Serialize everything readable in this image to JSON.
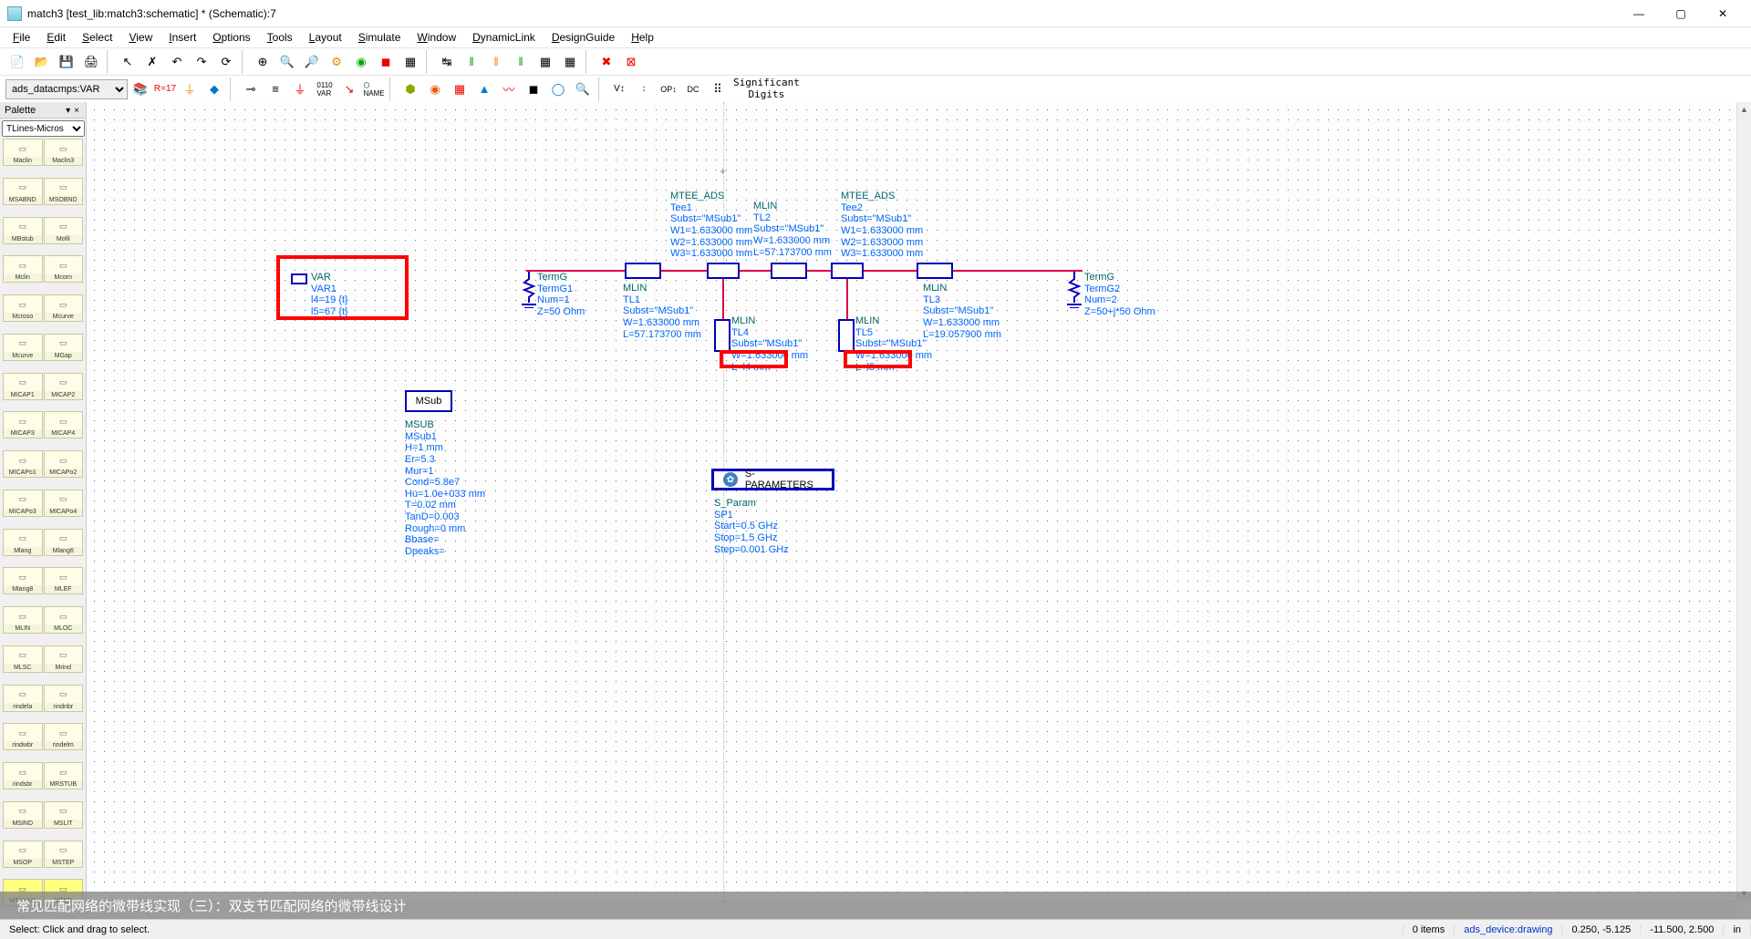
{
  "titlebar": {
    "title": "match3 [test_lib:match3:schematic] * (Schematic):7"
  },
  "menubar": [
    "File",
    "Edit",
    "Select",
    "View",
    "Insert",
    "Options",
    "Tools",
    "Layout",
    "Simulate",
    "Window",
    "DynamicLink",
    "DesignGuide",
    "Help"
  ],
  "toolbar2_combo": "ads_datacmps:VAR",
  "toolbar2_label": "Significant\nDigits",
  "palette": {
    "title": "Palette",
    "combo": "TLines-Micros",
    "items": [
      "Maclin",
      "Maclin3",
      "MSABND",
      "MSOBND",
      "MBstub",
      "Mofil",
      "Mclin",
      "Mcorn",
      "Mcroso",
      "Mcurve",
      "Mcurve",
      "MGap",
      "MICAP1",
      "MICAP2",
      "MICAP3",
      "MICAP4",
      "MICAPo1",
      "MICAPo2",
      "MICAPo3",
      "MICAPo4",
      "Mlang",
      "Mlang6",
      "Mlang8",
      "MLEF",
      "MLIN",
      "MLOC",
      "MLSC",
      "Mrind",
      "rindela",
      "rindnbr",
      "rindwbr",
      "rindelm",
      "rindsbr",
      "MRSTUB",
      "MSIND",
      "MSLIT",
      "MSOP",
      "MSTEP",
      "MTAPER",
      "MTEE"
    ]
  },
  "schematic": {
    "var_block": {
      "title": "VAR",
      "name": "VAR1",
      "lines": [
        "l4=19 {t}",
        "l5=67 {t}"
      ]
    },
    "msub_title": "MSub",
    "msub_block": {
      "type": "MSUB",
      "name": "MSub1",
      "lines": [
        "H=1 mm",
        "Er=5.3",
        "Mur=1",
        "Cond=5.8e7",
        "Hu=1.0e+033 mm",
        "T=0.02 mm",
        "TanD=0.003",
        "Rough=0 mm",
        "Bbase=",
        "Dpeaks="
      ]
    },
    "mtee1": {
      "type": "MTEE_ADS",
      "name": "Tee1",
      "lines": [
        "Subst=\"MSub1\"",
        "W1=1.633000 mm",
        "W2=1.633000 mm",
        "W3=1.633000 mm"
      ]
    },
    "mtee2": {
      "type": "MTEE_ADS",
      "name": "Tee2",
      "lines": [
        "Subst=\"MSub1\"",
        "W1=1.633000 mm",
        "W2=1.633000 mm",
        "W3=1.633000 mm"
      ]
    },
    "mlin_tl1": {
      "type": "MLIN",
      "name": "TL1",
      "lines": [
        "Subst=\"MSub1\"",
        "W=1.633000 mm",
        "L=57.173700 mm"
      ]
    },
    "mlin_tl2": {
      "type": "MLIN",
      "name": "TL2",
      "lines": [
        "Subst=\"MSub1\"",
        "W=1.633000 mm",
        "L=57.173700 mm"
      ]
    },
    "mlin_tl3": {
      "type": "MLIN",
      "name": "TL3",
      "lines": [
        "Subst=\"MSub1\"",
        "W=1.633000 mm",
        "L=19.057900 mm"
      ]
    },
    "mlin_tl4": {
      "type": "MLIN",
      "name": "TL4",
      "lines": [
        "Subst=\"MSub1\"",
        "W=1.633000 mm",
        "L=l4 mm"
      ]
    },
    "mlin_tl5": {
      "type": "MLIN",
      "name": "TL5",
      "lines": [
        "Subst=\"MSub1\"",
        "W=1.633000 mm",
        "L=l5 mm"
      ]
    },
    "termg1": {
      "type": "TermG",
      "name": "TermG1",
      "lines": [
        "Num=1",
        "Z=50 Ohm"
      ]
    },
    "termg2": {
      "type": "TermG",
      "name": "TermG2",
      "lines": [
        "Num=2",
        "Z=50+j*50 Ohm"
      ]
    },
    "sparam_title": "S-PARAMETERS",
    "sparam_block": {
      "type": "S_Param",
      "name": "SP1",
      "lines": [
        "Start=0.5 GHz",
        "Stop=1.5 GHz",
        "Step=0.001 GHz"
      ]
    }
  },
  "caption": "常见匹配网络的微带线实现（三）：双支节匹配网络的微带线设计",
  "statusbar": {
    "hint": "Select: Click and drag to select.",
    "items": "0 items",
    "layer": "ads_device:drawing",
    "coord1": "0.250, -5.125",
    "coord2": "-11.500, 2.500",
    "unit": "in"
  }
}
